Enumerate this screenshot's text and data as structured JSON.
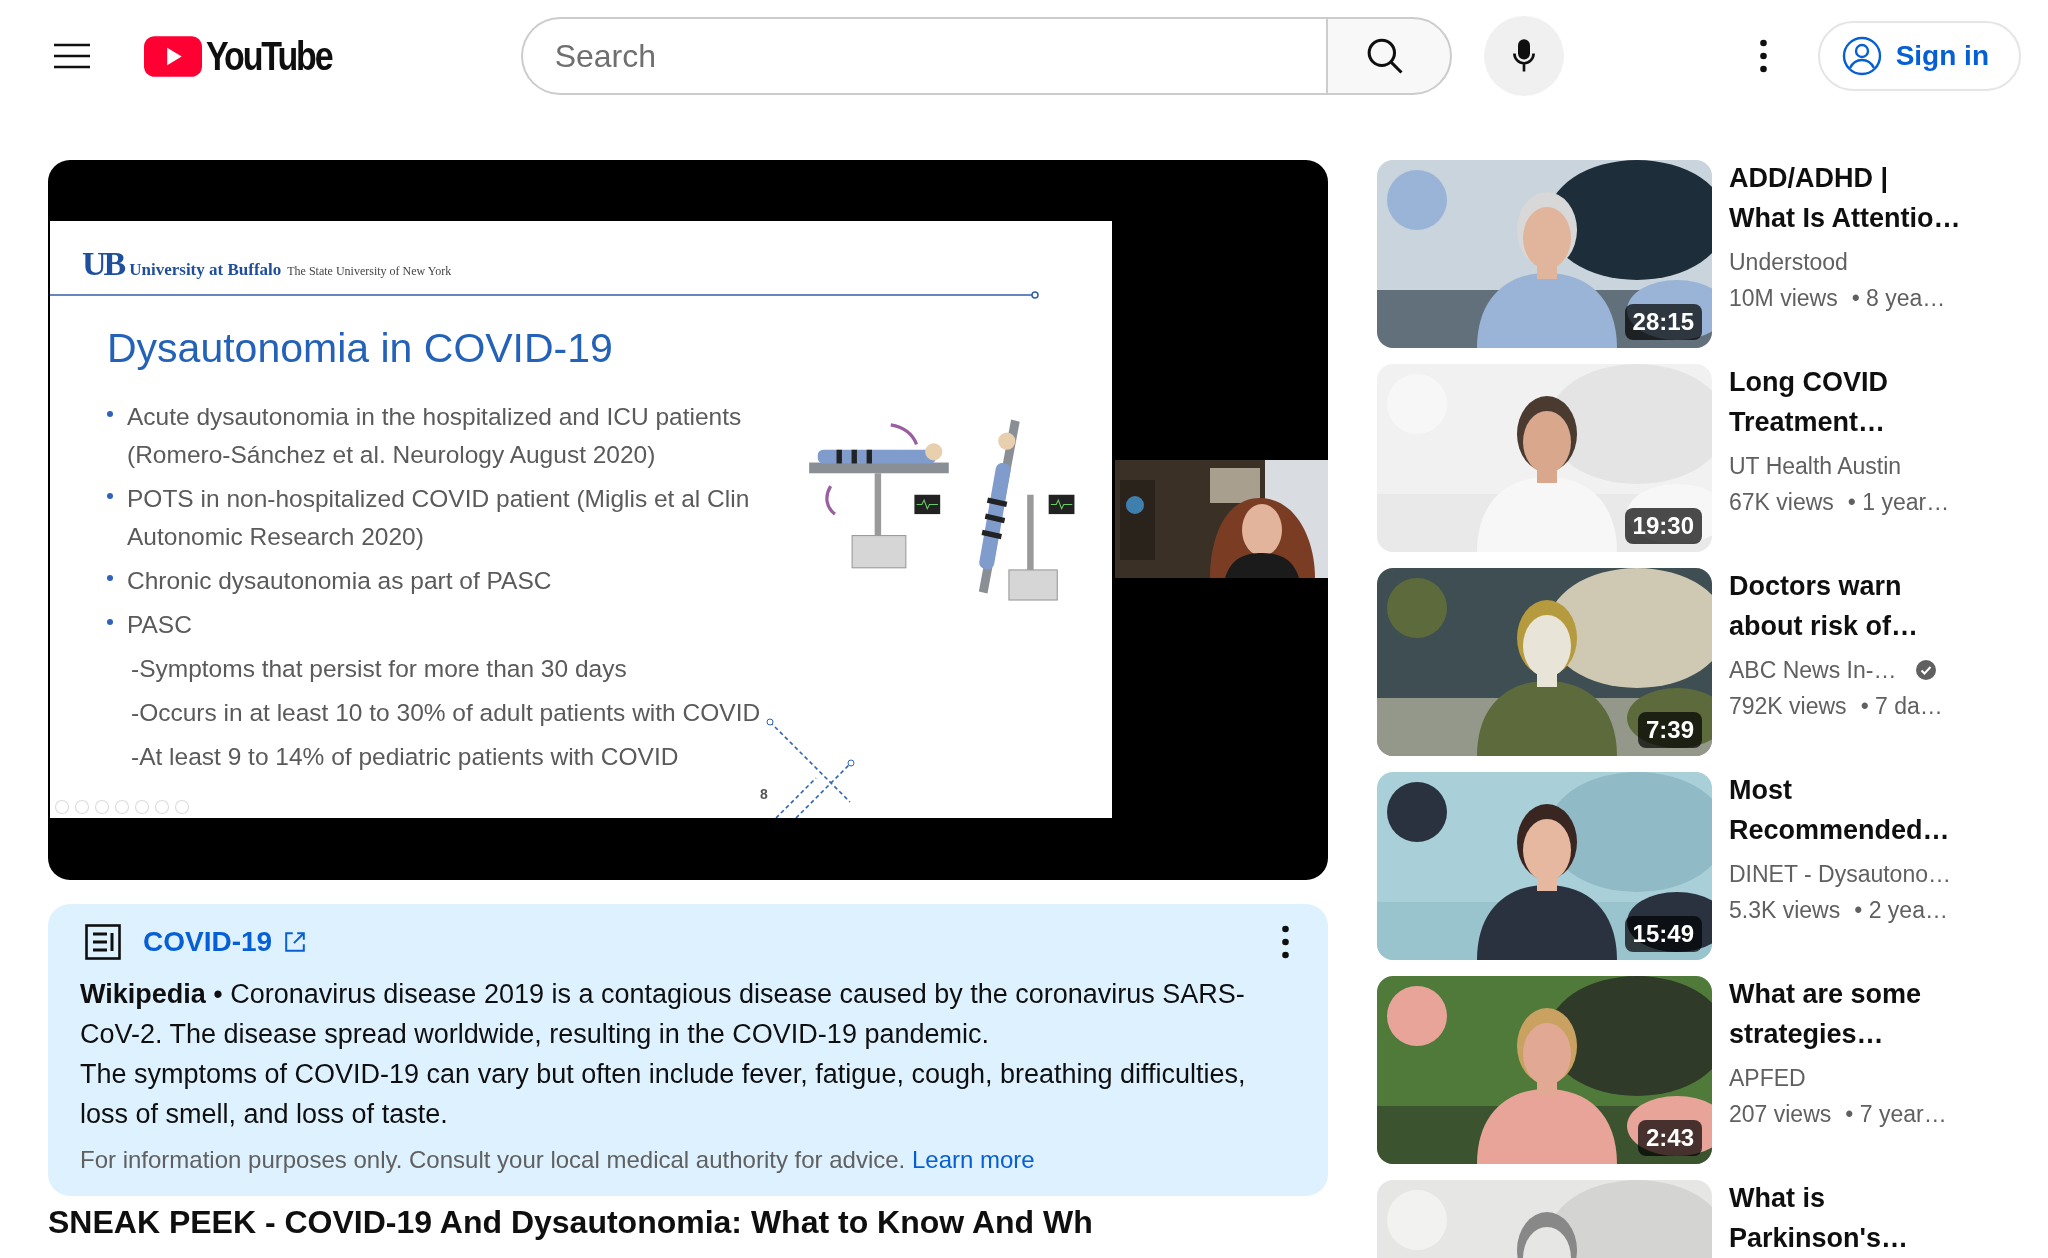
{
  "header": {
    "logo_text": "YouTube",
    "search": {
      "placeholder": "Search"
    },
    "sign_in": "Sign in"
  },
  "player": {
    "slide": {
      "logo_mark": "UB",
      "university": "University at Buffalo",
      "tagline": "The State University of New York",
      "title": "Dysautonomia in COVID-19",
      "page_number": "8",
      "points": [
        {
          "kind": "bullet",
          "text": "Acute dysautonomia in the hospitalized and ICU patients\n(Romero-Sánchez et al. Neurology August 2020)"
        },
        {
          "kind": "bullet",
          "text": "POTS in non-hospitalized COVID patient (Miglis et al Clin\nAutonomic Research 2020)"
        },
        {
          "kind": "bullet",
          "text": "Chronic dysautonomia as part of PASC"
        },
        {
          "kind": "bullet",
          "text": "PASC"
        },
        {
          "kind": "sub",
          "text": "-Symptoms that persist for more than 30 days"
        },
        {
          "kind": "sub",
          "text": "-Occurs in at least 10 to 30% of adult patients with COVID"
        },
        {
          "kind": "sub",
          "text": "-At least 9 to 14% of pediatric patients with COVID"
        }
      ]
    }
  },
  "info_panel": {
    "title": "COVID-19",
    "paragraphs": [
      "**Wikipedia** • Coronavirus disease 2019 is a contagious disease caused by the coronavirus SARS-CoV-2. The disease spread worldwide, resulting in the COVID-19 pandemic.",
      "The symptoms of COVID-19 can vary but often include fever, fatigue, cough, breathing difficulties, loss of smell, and loss of taste."
    ],
    "disclaimer": "For information purposes only. Consult your local medical authority for advice.",
    "link": "Learn more"
  },
  "video_title": "SNEAK PEEK - COVID-19 And Dysautonomia: What to Know And Wh",
  "recommendations": [
    {
      "title": "ADD/ADHD |\nWhat Is Attentio…",
      "channel": "Understood",
      "verified": false,
      "views": "10M views",
      "age": "• 8 yea…",
      "duration": "28:15"
    },
    {
      "title": "Long COVID\nTreatment…",
      "channel": "UT Health Austin",
      "verified": false,
      "views": "67K views",
      "age": "• 1 year…",
      "duration": "19:30"
    },
    {
      "title": "Doctors warn\nabout risk of…",
      "channel": "ABC News In-…",
      "verified": true,
      "views": "792K views",
      "age": "• 7 da…",
      "duration": "7:39"
    },
    {
      "title": "Most\nRecommended…",
      "channel": "DINET - Dysautono…",
      "verified": false,
      "views": "5.3K views",
      "age": "• 2 yea…",
      "duration": "15:49"
    },
    {
      "title": "What are some\nstrategies…",
      "channel": "APFED",
      "verified": false,
      "views": "207 views",
      "age": "• 7 year…",
      "duration": "2:43"
    },
    {
      "title": "What is\nParkinson's…"
    }
  ]
}
